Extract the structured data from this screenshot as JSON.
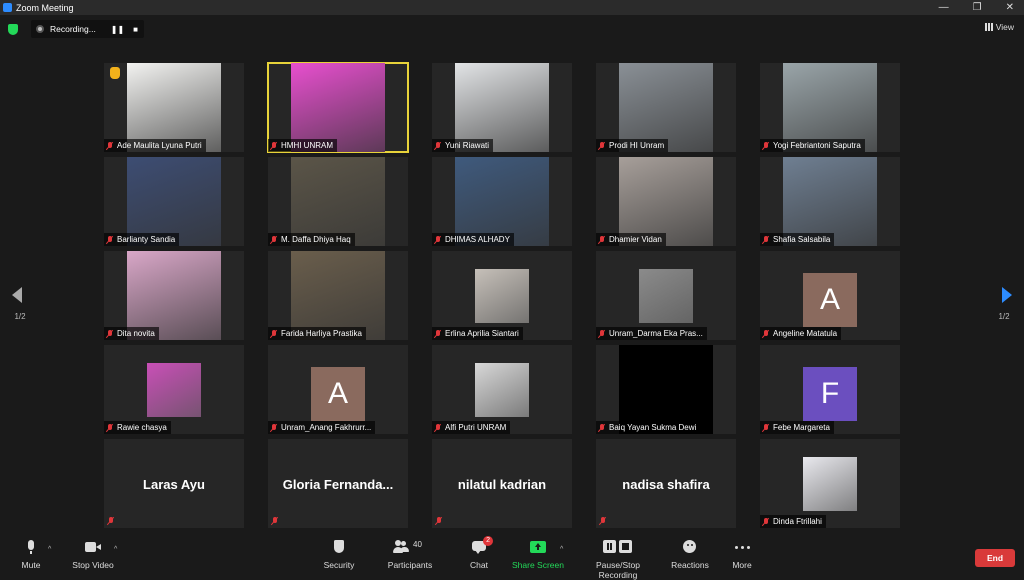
{
  "window": {
    "title": "Zoom Meeting",
    "controls": [
      "—",
      "❐",
      "✕"
    ]
  },
  "top": {
    "recording_label": "Recording...",
    "pause_glyph": "❚❚",
    "stop_glyph": "■",
    "view_label": "View"
  },
  "pager": {
    "left": "1/2",
    "right": "1/2"
  },
  "participants": [
    {
      "name": "Ade Maulita Lyuna Putri",
      "type": "video",
      "color": "#f3f3f1",
      "hand": true
    },
    {
      "name": "HMHI UNRAM",
      "type": "video",
      "color": "#e84fcf",
      "active": true
    },
    {
      "name": "Yuni Riawati",
      "type": "video",
      "color": "#e2e4e6"
    },
    {
      "name": "Prodi HI Unram",
      "type": "video",
      "color": "#8a9096"
    },
    {
      "name": "Yogi Febriantoni Saputra",
      "type": "video",
      "color": "#9aa5a9"
    },
    {
      "name": "Barlianty Sandia",
      "type": "video",
      "color": "#3d4d73"
    },
    {
      "name": "M. Daffa Dhiya Haq",
      "type": "video",
      "color": "#5b5548"
    },
    {
      "name": "DHIMAS ALHADY",
      "type": "video",
      "color": "#3f5a7d"
    },
    {
      "name": "Dhamier Vidan",
      "type": "video",
      "color": "#a79f9a"
    },
    {
      "name": "Shafia Salsabila",
      "type": "video",
      "color": "#6f7f92"
    },
    {
      "name": "Dita novita",
      "type": "video",
      "color": "#d9a7c8"
    },
    {
      "name": "Farida Harliya Prastika",
      "type": "video",
      "color": "#6a5e4c"
    },
    {
      "name": "Erlina Aprilia Siantari",
      "type": "thumb",
      "color": "#c6c0b9"
    },
    {
      "name": "Unram_Darma Eka Pras...",
      "type": "thumb",
      "color": "#8b8b8b"
    },
    {
      "name": "Angeline Matatula",
      "type": "avatar",
      "letter": "A",
      "color": "#8a6a5e"
    },
    {
      "name": "Rawie chasya",
      "type": "thumb",
      "color": "#c94fb7"
    },
    {
      "name": "Unram_Anang Fakhrurr...",
      "type": "avatar",
      "letter": "A",
      "color": "#8a6a5e"
    },
    {
      "name": "Alfi Putri UNRAM",
      "type": "thumb",
      "color": "#d8d8d8"
    },
    {
      "name": "Baiq Yayan Sukma Dewi",
      "type": "video",
      "color": "#000000"
    },
    {
      "name": "Febe Margareta",
      "type": "avatar",
      "letter": "F",
      "color": "#6b4fbf"
    },
    {
      "name": "Laras Ayu",
      "type": "text"
    },
    {
      "name": "Gloria  Fernanda...",
      "type": "text"
    },
    {
      "name": "nilatul kadrian",
      "type": "text"
    },
    {
      "name": "nadisa shafira",
      "type": "text"
    },
    {
      "name": "Dinda Ftrillahi",
      "type": "thumb",
      "color": "#e9e9ee"
    }
  ],
  "toolbar": {
    "mute": "Mute",
    "stop_video": "Stop Video",
    "security": "Security",
    "participants": "Participants",
    "participants_count": "40",
    "chat": "Chat",
    "chat_badge": "2",
    "share": "Share Screen",
    "recording": "Pause/Stop Recording",
    "reactions": "Reactions",
    "more": "More",
    "end": "End",
    "caret": "^"
  },
  "colors": {
    "accent": "#2d8cff",
    "share_green": "#23d959",
    "end_red": "#d93a3a",
    "active_outline": "#e8d33a"
  }
}
